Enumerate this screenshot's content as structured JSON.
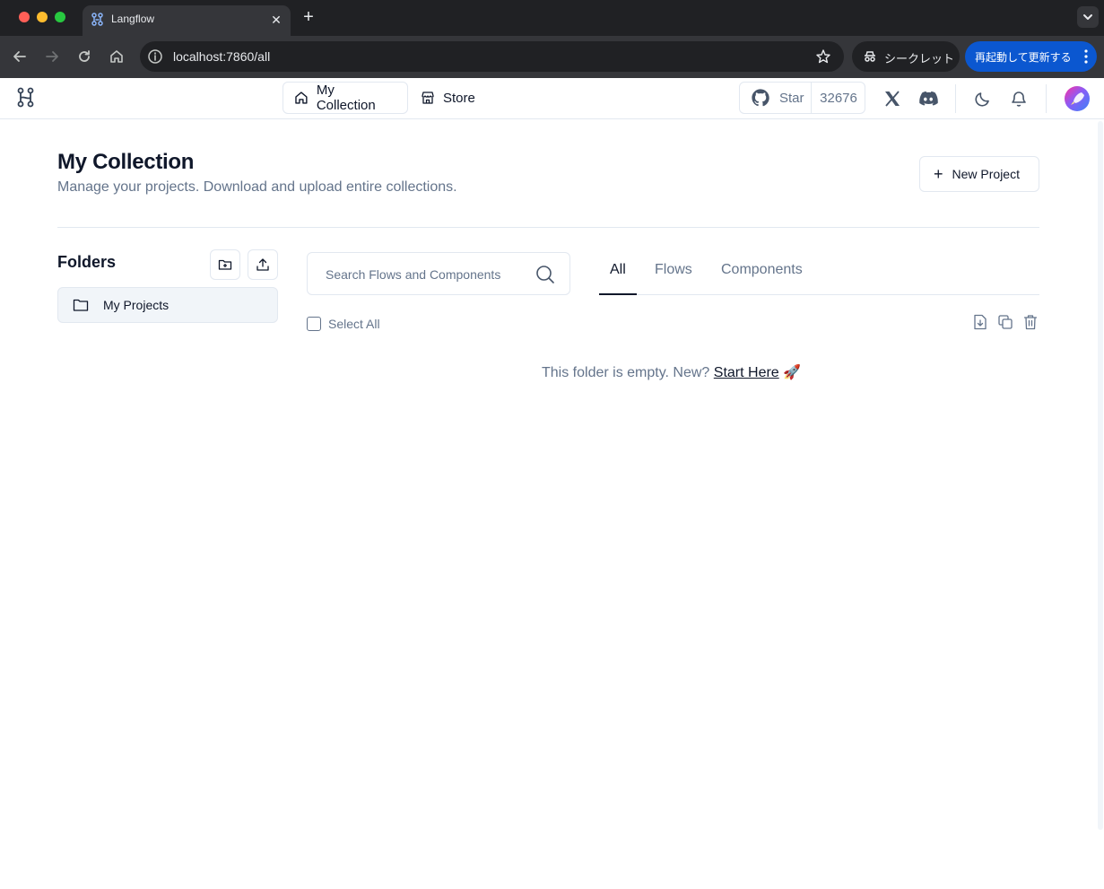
{
  "browser": {
    "tab_title": "Langflow",
    "url": "localhost:7860/all",
    "incognito_label": "シークレット",
    "relaunch_label": "再起動して更新する"
  },
  "header": {
    "nav": [
      {
        "label": "My Collection",
        "icon": "home-icon"
      },
      {
        "label": "Store",
        "icon": "store-icon"
      }
    ],
    "github_star_label": "Star",
    "github_star_count": "32676",
    "icons": [
      "x-twitter-icon",
      "discord-icon",
      "moon-icon",
      "bell-icon"
    ]
  },
  "main": {
    "title": "My Collection",
    "subtitle": "Manage your projects. Download and upload entire collections.",
    "new_project_label": "New Project"
  },
  "folders": {
    "title": "Folders",
    "items": [
      {
        "label": "My Projects"
      }
    ]
  },
  "search": {
    "placeholder": "Search Flows and Components"
  },
  "tabs": [
    {
      "label": "All",
      "active": true
    },
    {
      "label": "Flows",
      "active": false
    },
    {
      "label": "Components",
      "active": false
    }
  ],
  "select_all_label": "Select All",
  "empty_state": {
    "text": "This folder is empty. New?",
    "link": "Start Here",
    "emoji": "🚀"
  },
  "colors": {
    "relaunch_blue": "#0b57d0",
    "text_primary": "#0f172a",
    "text_muted": "#64748b",
    "border": "#e2e8f0"
  }
}
